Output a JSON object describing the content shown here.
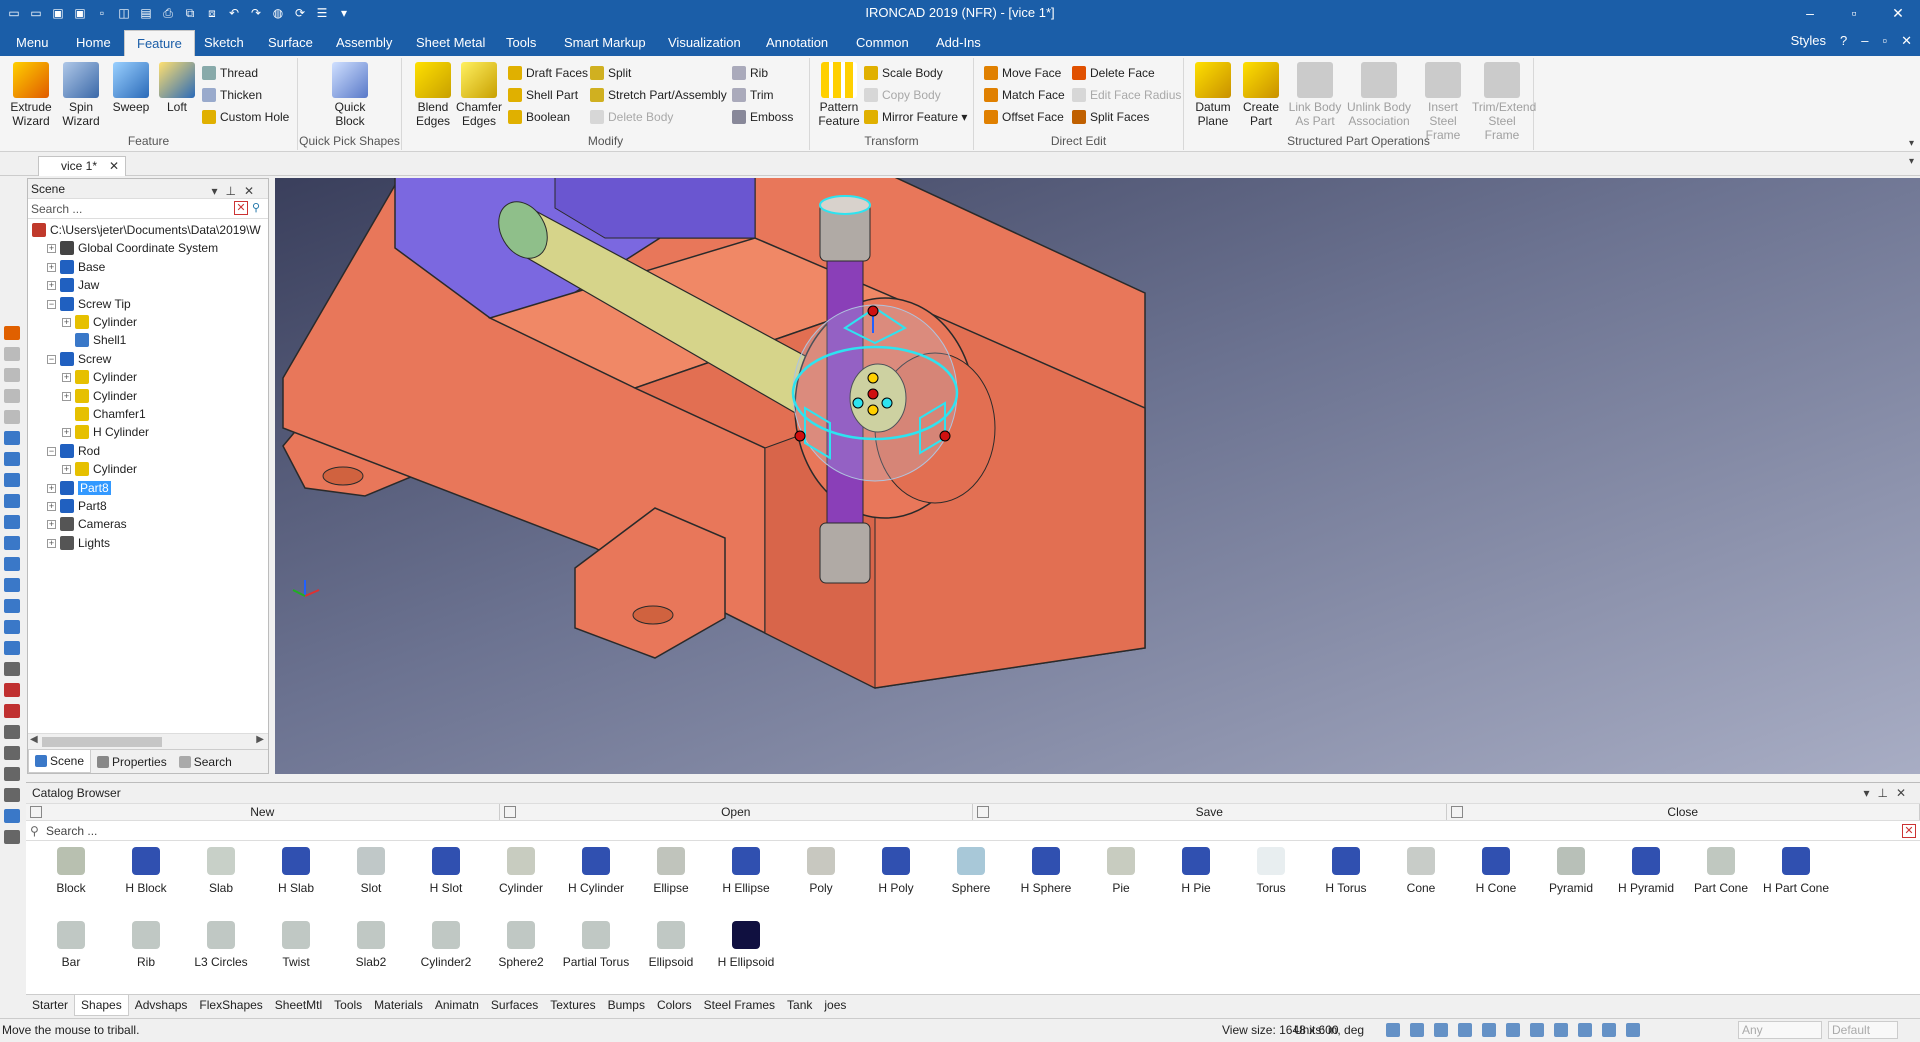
{
  "window": {
    "title": "IRONCAD 2019 (NFR) - [vice 1*]",
    "controls": [
      "–",
      "▫",
      "✕"
    ]
  },
  "menu": {
    "tabs": [
      "Menu",
      "Home",
      "Feature",
      "Sketch",
      "Surface",
      "Assembly",
      "Sheet Metal",
      "Tools",
      "Smart Markup",
      "Visualization",
      "Annotation",
      "Common",
      "Add-Ins"
    ],
    "active": "Feature",
    "styles_label": "Styles"
  },
  "ribbon": {
    "feature": {
      "extrude": "Extrude Wizard",
      "spin": "Spin Wizard",
      "sweep": "Sweep",
      "loft": "Loft",
      "thread": "Thread",
      "thicken": "Thicken",
      "custom_hole": "Custom Hole",
      "label": "Feature"
    },
    "quick_pick": {
      "quick_block": "Quick Block",
      "label": "Quick Pick Shapes"
    },
    "modify": {
      "blend_edges": "Blend Edges",
      "chamfer_edges": "Chamfer Edges",
      "draft_faces": "Draft Faces",
      "shell_part": "Shell Part",
      "boolean": "Boolean",
      "split": "Split",
      "stretch": "Stretch Part/Assembly",
      "delete_body": "Delete Body",
      "rib": "Rib",
      "trim": "Trim",
      "emboss": "Emboss",
      "label": "Modify"
    },
    "transform": {
      "pattern_feature": "Pattern Feature",
      "scale_body": "Scale Body",
      "copy_body": "Copy Body",
      "mirror_feature": "Mirror Feature",
      "label": "Transform"
    },
    "direct_edit": {
      "move_face": "Move Face",
      "match_face": "Match Face",
      "offset_face": "Offset Face",
      "delete_face": "Delete Face",
      "edit_face_radius": "Edit Face Radius",
      "split_faces": "Split Faces",
      "label": "Direct Edit"
    },
    "structured": {
      "datum_plane": "Datum Plane",
      "create_part": "Create Part",
      "link_body": "Link Body As Part",
      "unlink_body": "Unlink Body Association",
      "insert_steel": "Insert Steel Frame",
      "trim_extend": "Trim/Extend Steel Frame",
      "label": "Structured Part Operations"
    }
  },
  "doc_tab": "vice 1*",
  "scene": {
    "title": "Scene",
    "search_placeholder": "Search ...",
    "items": [
      {
        "label": "C:\\Users\\jeter\\Documents\\Data\\2019\\W",
        "level": 0,
        "expander": "",
        "icon": "#c0392b"
      },
      {
        "label": "Global Coordinate System",
        "level": 1,
        "expander": "+",
        "icon": "#444"
      },
      {
        "label": "Base",
        "level": 1,
        "expander": "+",
        "icon": "#2060c0"
      },
      {
        "label": "Jaw",
        "level": 1,
        "expander": "+",
        "icon": "#2060c0"
      },
      {
        "label": "Screw Tip",
        "level": 1,
        "expander": "−",
        "icon": "#2060c0"
      },
      {
        "label": "Cylinder",
        "level": 2,
        "expander": "+",
        "icon": "#e6c000"
      },
      {
        "label": "Shell1",
        "level": 2,
        "expander": "",
        "icon": "#3a78c8"
      },
      {
        "label": "Screw",
        "level": 1,
        "expander": "−",
        "icon": "#2060c0"
      },
      {
        "label": "Cylinder",
        "level": 2,
        "expander": "+",
        "icon": "#e6c000"
      },
      {
        "label": "Cylinder",
        "level": 2,
        "expander": "+",
        "icon": "#e6c000"
      },
      {
        "label": "Chamfer1",
        "level": 2,
        "expander": "",
        "icon": "#e6c000"
      },
      {
        "label": "H Cylinder",
        "level": 2,
        "expander": "+",
        "icon": "#e6c000"
      },
      {
        "label": "Rod",
        "level": 1,
        "expander": "−",
        "icon": "#2060c0"
      },
      {
        "label": "Cylinder",
        "level": 2,
        "expander": "+",
        "icon": "#e6c000"
      },
      {
        "label": "Part8",
        "level": 1,
        "expander": "+",
        "icon": "#2060c0",
        "selected": true
      },
      {
        "label": "Part8",
        "level": 1,
        "expander": "+",
        "icon": "#2060c0"
      },
      {
        "label": "Cameras",
        "level": 1,
        "expander": "+",
        "icon": "#555"
      },
      {
        "label": "Lights",
        "level": 1,
        "expander": "+",
        "icon": "#555"
      }
    ],
    "footer_tabs": [
      "Scene",
      "Properties",
      "Search"
    ]
  },
  "catalog": {
    "title": "Catalog Browser",
    "buttons": [
      "New",
      "Open",
      "Save",
      "Close"
    ],
    "search_placeholder": "Search ...",
    "shapes_row1": [
      "Block",
      "H Block",
      "Slab",
      "H Slab",
      "Slot",
      "H Slot",
      "Cylinder",
      "H Cylinder",
      "Ellipse",
      "H Ellipse",
      "Poly",
      "H Poly",
      "Sphere",
      "H Sphere",
      "Pie",
      "H Pie",
      "Torus",
      "H Torus",
      "Cone",
      "H Cone",
      "Pyramid",
      "H Pyramid",
      "Part Cone",
      "H Part Cone"
    ],
    "shapes_row2": [
      "Bar",
      "Rib",
      "L3 Circles",
      "Twist",
      "Slab2",
      "Cylinder2",
      "Sphere2",
      "Partial Torus",
      "Ellipsoid",
      "H Ellipsoid"
    ]
  },
  "bottom_tabs": [
    "Starter",
    "Shapes",
    "Advshaps",
    "FlexShapes",
    "SheetMtl",
    "Tools",
    "Materials",
    "Animatn",
    "Surfaces",
    "Textures",
    "Bumps",
    "Colors",
    "Steel Frames",
    "Tank",
    "joes"
  ],
  "bottom_active": "Shapes",
  "status": {
    "message": "Move the mouse to triball.",
    "view_size": "View size: 1648 x 600",
    "units": "Units: in, deg",
    "select1": "Any",
    "select2": "Default"
  },
  "colors": {
    "accent": "#1b5ea8",
    "vice_body": "#e8775a",
    "vice_jaw_face": "#7b68e0",
    "screw": "#d6d48a",
    "rod": "#8a3fb8",
    "triball": "#2ee3f0"
  }
}
